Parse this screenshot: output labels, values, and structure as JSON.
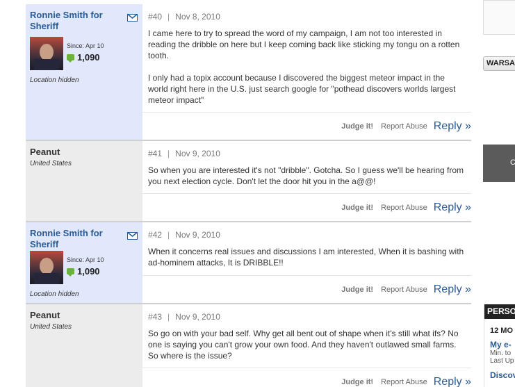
{
  "posts": [
    {
      "author": "Ronnie Smith for Sheriff",
      "author_kind": "member",
      "since": "Since: Apr 10",
      "post_count": "1,090",
      "location": "Location hidden",
      "number": "#40",
      "date": "Nov 8, 2010",
      "paragraphs": [
        "I came here to try to spread the word of my campaign, I am not too interested in reading the dribble on here but I keep coming back like sticking my tongu on a rotten tooth.",
        "I only had a topix account because I discovered the biggest meteor impact in the world right here in the U.S. just search google for \"pothead discovers worlds largest meteor impact\""
      ]
    },
    {
      "author": "Peanut",
      "author_kind": "guest",
      "location": "United States",
      "number": "#41",
      "date": "Nov 9, 2010",
      "paragraphs": [
        "So when you are interested it's not \"dribble\". Gotcha. So I guess we'll be hearing from you next election cycle. Don't let the door hit you in the a@@!"
      ]
    },
    {
      "author": "Ronnie Smith for Sheriff",
      "author_kind": "member",
      "since": "Since: Apr 10",
      "post_count": "1,090",
      "location": "Location hidden",
      "number": "#42",
      "date": "Nov 9, 2010",
      "paragraphs": [
        "When it concerns real issues and discussions I am interested, When it is bashing with ad-hominem attacks, It is DRIBBLE!!"
      ]
    },
    {
      "author": "Peanut",
      "author_kind": "guest",
      "location": "United States",
      "number": "#43",
      "date": "Nov 9, 2010",
      "paragraphs": [
        "So go on with your bad self. Why get all bent out of shape when it's still what ifs? No one is saying you can't grow your own food. And they haven't outlawed small farms. So where is the issue?"
      ]
    }
  ],
  "actions": {
    "judge": "Judge it!",
    "report": "Report Abuse",
    "reply": "Reply »"
  },
  "right_column": {
    "button_text": "WARSA",
    "dark_box_text": "C",
    "panel_header": "PERSO",
    "panel_line1": "12 MO",
    "panel_link1": "My e-",
    "panel_small1": "Min. to",
    "panel_small2": "Last Up",
    "panel_link2": "Discov"
  },
  "colors": {
    "author_bg": "#e2e8fb",
    "guest_bg": "#ececec",
    "link": "#2a5a94",
    "badge_green": "#6cb33e"
  },
  "icons": [
    "envelope-icon",
    "message-bubble-icon"
  ]
}
